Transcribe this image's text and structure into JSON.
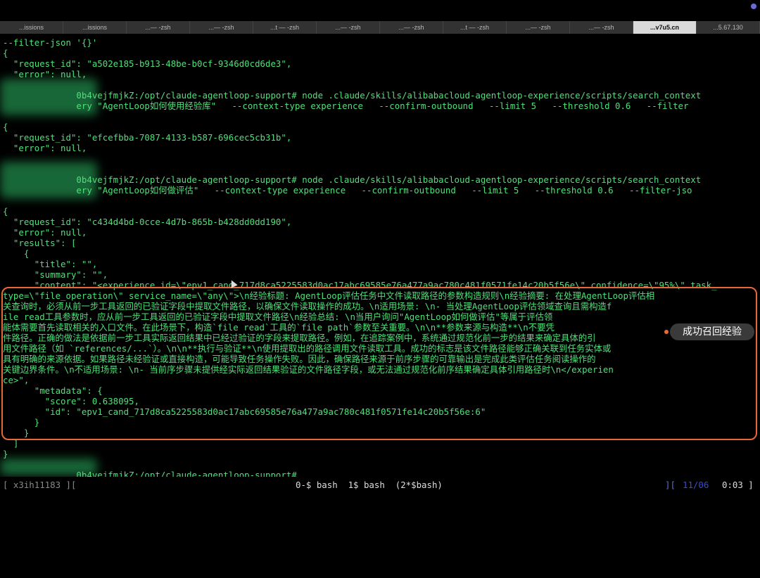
{
  "tabs": [
    {
      "label": "...issions"
    },
    {
      "label": "...issions"
    },
    {
      "label": "...— -zsh"
    },
    {
      "label": "...— -zsh"
    },
    {
      "label": "...t — -zsh"
    },
    {
      "label": "...— -zsh"
    },
    {
      "label": "...— -zsh"
    },
    {
      "label": "...t — -zsh"
    },
    {
      "label": "...— -zsh"
    },
    {
      "label": "...— -zsh"
    },
    {
      "label": "...v7u5.cn"
    },
    {
      "label": "...5.67.130"
    }
  ],
  "terminal": {
    "lines": [
      "--filter-json '{}'",
      "{",
      "  \"request_id\": \"a502e185-b913-48be-b0cf-9346d0cd6de3\",",
      "  \"error\": null,",
      "",
      "              0b4vejfmjkZ:/opt/claude-agentloop-support# node .claude/skills/alibabacloud-agentloop-experience/scripts/search_context",
      "              ery \"AgentLoop如何使用经验库\"   --context-type experience   --confirm-outbound   --limit 5   --threshold 0.6   --filter",
      "",
      "{",
      "  \"request_id\": \"efcefbba-7087-4133-b587-696cec5cb31b\",",
      "  \"error\": null,",
      "",
      "",
      "              0b4vejfmjkZ:/opt/claude-agentloop-support# node .claude/skills/alibabacloud-agentloop-experience/scripts/search_context",
      "              ery \"AgentLoop如何做评估\"   --context-type experience   --confirm-outbound   --limit 5   --threshold 0.6   --filter-jso",
      "",
      "{",
      "  \"request_id\": \"c434d4bd-0cce-4d7b-865b-b428dd0dd190\",",
      "  \"error\": null,",
      "  \"results\": [",
      "    {",
      "      \"title\": \"\",",
      "      \"summary\": \"\",",
      "      \"content\": \"<experience id=\\\"epv1_cand_717d8ca5225583d0ac17abc69585e76a477a9ac780c481f0571fe14c20b5f56e\\\" confidence=\\\"95%\\\" task_",
      "type=\\\"file_operation\\\" service_name=\\\"any\\\">\\n经验标题: AgentLoop评估任务中文件读取路径的参数构造规则\\n经验摘要: 在处理AgentLoop评估相",
      "关查询时，必须从前一步工具返回的已验证字段中提取文件路径，以确保文件读取操作的成功。\\n适用场景: \\n- 当处理AgentLoop评估领域查询且需构造f",
      "ile read工具参数时，应从前一步工具返回的已验证字段中提取文件路径\\n经验总结: \\n当用户询问\"AgentLoop如何做评估\"等属于评估领",
      "能体需要首先读取相关的入口文件。在此场景下，构造`file read`工具的`file path`参数至关重要。\\n\\n**参数来源与构造**\\n不要凭",
      "件路径。正确的做法是依据前一步工具实际返回结果中已经过验证的字段来提取路径。例如，在追踪案例中，系统通过规范化前一步的结果来确定具体的引",
      "用文件路径（如 `references/...`）。\\n\\n**执行与验证**\\n使用提取出的路径调用文件读取工具。成功的标志是该文件路径能够正确关联到任务实体或",
      "具有明确的来源依据。如果路径未经验证或直接构造，可能导致任务操作失败。因此，确保路径来源于前序步骤的可靠输出是完成此类评估任务阅读操作的",
      "关键边界条件。\\n不适用场景: \\n- 当前序步骤未提供经实际返回结果验证的文件路径字段，或无法通过规范化前序结果确定具体引用路径时\\n</experien",
      "ce>\",",
      "      \"metadata\": {",
      "        \"score\": 0.638095,",
      "        \"id\": \"epv1_cand_717d8ca5225583d0ac17abc69585e76a477a9ac780c481f0571fe14c20b5f56e:6\"",
      "      }",
      "    }",
      "  ]",
      "}",
      "",
      "              0b4vejfmjkZ:/opt/claude-agentloop-support#"
    ]
  },
  "callout": {
    "label": "成功召回经验"
  },
  "statusbar": {
    "left": "[ x3ih11183 ][",
    "windows": "0-$ bash  1$ bash  (2*$bash)",
    "right_bracket": "][",
    "date": "11/06",
    "time": "0:03 ]"
  },
  "colors": {
    "terminal_text": "#4fe07a",
    "highlight_border": "#e9683a",
    "callout_bg": "#3a3a3a"
  }
}
